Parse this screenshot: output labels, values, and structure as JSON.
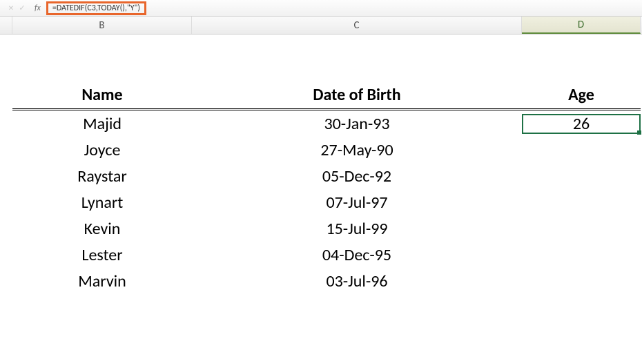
{
  "formulaBar": {
    "fx_label": "fx",
    "formula": "=DATEDIF(C3,TODAY(),\"Y\")",
    "accept_icon": "✓",
    "cancel_icon": "✕"
  },
  "columns": {
    "B": "B",
    "C": "C",
    "D": "D"
  },
  "headers": {
    "name": "Name",
    "dob": "Date of Birth",
    "age": "Age"
  },
  "rows": [
    {
      "name": "Majid",
      "dob": "30-Jan-93",
      "age": "26"
    },
    {
      "name": "Joyce",
      "dob": "27-May-90",
      "age": ""
    },
    {
      "name": "Raystar",
      "dob": "05-Dec-92",
      "age": ""
    },
    {
      "name": "Lynart",
      "dob": "07-Jul-97",
      "age": ""
    },
    {
      "name": "Kevin",
      "dob": "15-Jul-99",
      "age": ""
    },
    {
      "name": "Lester",
      "dob": "04-Dec-95",
      "age": ""
    },
    {
      "name": "Marvin",
      "dob": "03-Jul-96",
      "age": ""
    }
  ],
  "highlight": {
    "color": "#e8662c"
  },
  "activeCell": {
    "border_color": "#1e7145"
  }
}
